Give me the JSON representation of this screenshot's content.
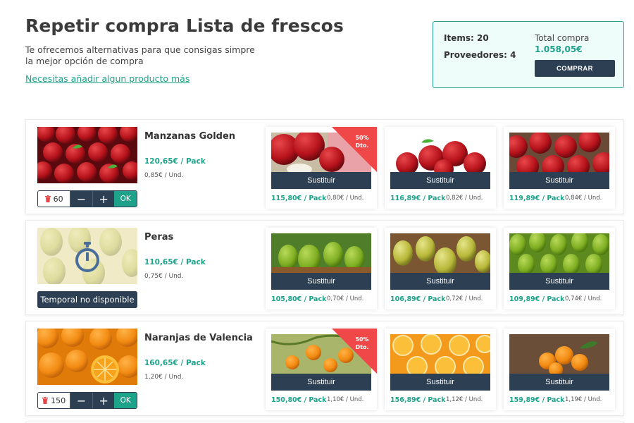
{
  "header": {
    "title": "Repetir compra Lista de frescos",
    "subtitle": "Te ofrecemos alternativas para que consigas simpre la mejor opción de compra",
    "link": "Necesitas añadir algun producto más"
  },
  "summary": {
    "items": "Items: 20",
    "providers": "Proveedores: 4",
    "total_label": "Total compra",
    "total_value": "1.058,05€",
    "buy_label": "COMPRAR"
  },
  "colors": {
    "accent": "#1ea38a",
    "dark": "#2d3f52",
    "ribbon": "#f04848"
  },
  "products": [
    {
      "name": "Manzanas Golden",
      "price": "120,65€ / Pack",
      "unit": "0,85€ / Und.",
      "quantity": "60",
      "ok_label": "OK",
      "alternatives": [
        {
          "price": "115,80€ / Pack",
          "unit": "0,80€ / Und.",
          "button": "Sustituir",
          "badge": "50% Dto."
        },
        {
          "price": "116,89€ / Pack",
          "unit": "0,82€ / Und.",
          "button": "Sustituir"
        },
        {
          "price": "119,89€ / Pack",
          "unit": "0,84€ / Und.",
          "button": "Sustituir"
        }
      ]
    },
    {
      "name": "Peras",
      "price": "110,65€ / Pack",
      "unit": "0,75€ / Und.",
      "status": "Temporal no disponible",
      "alternatives": [
        {
          "price": "105,80€ / Pack",
          "unit": "0,70€ / Und.",
          "button": "Sustituir"
        },
        {
          "price": "106,89€ / Pack",
          "unit": "0,72€ / Und.",
          "button": "Sustituir"
        },
        {
          "price": "109,89€ / Pack",
          "unit": "0,74€ / Und.",
          "button": "Sustituir"
        }
      ]
    },
    {
      "name": "Naranjas de Valencia",
      "price": "160,65€ / Pack",
      "unit": "1,20€ / Und.",
      "quantity": "150",
      "ok_label": "OK",
      "alternatives": [
        {
          "price": "150,80€ / Pack",
          "unit": "1,10€ / Und.",
          "button": "Sustituir",
          "badge": "50% Dto."
        },
        {
          "price": "156,89€ / Pack",
          "unit": "1,12€ / Und.",
          "button": "Sustituir"
        },
        {
          "price": "159,89€ / Pack",
          "unit": "1,19€ / Und.",
          "button": "Sustituir"
        }
      ]
    }
  ]
}
